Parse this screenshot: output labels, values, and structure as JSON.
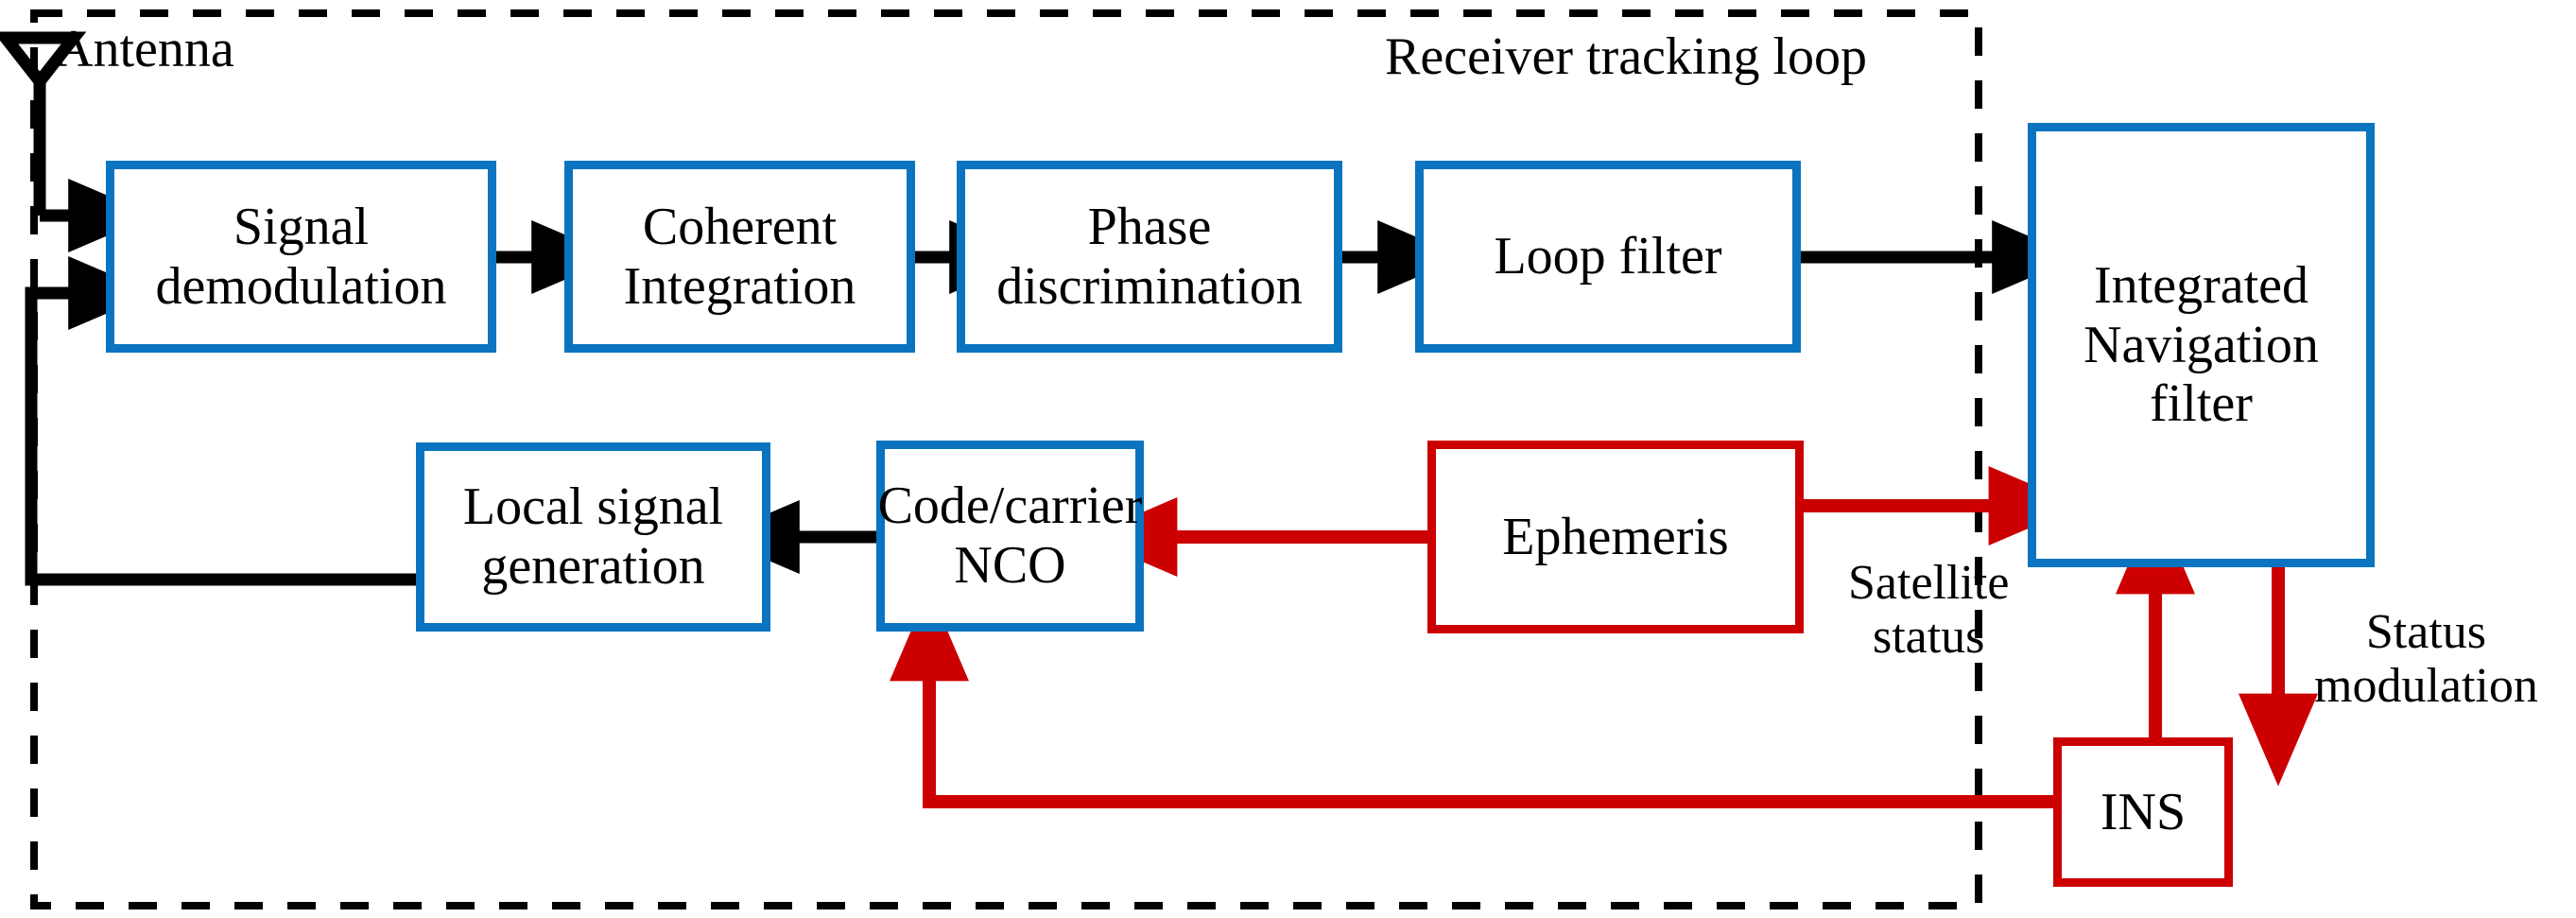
{
  "diagram": {
    "title_label": "Receiver tracking loop",
    "antenna_label": "Antenna",
    "satellite_status_label": "Satellite\nstatus",
    "status_modulation_label": "Status\nmodulation",
    "colors": {
      "blue": "#0a74c0",
      "red": "#cc0000",
      "black": "#000000",
      "background": "#ffffff"
    },
    "blocks": [
      {
        "id": "signal-demodulation",
        "label": "Signal\ndemodulation",
        "color": "blue"
      },
      {
        "id": "coherent-integration",
        "label": "Coherent\nIntegration",
        "color": "blue"
      },
      {
        "id": "phase-discrimination",
        "label": "Phase\ndiscrimination",
        "color": "blue"
      },
      {
        "id": "loop-filter",
        "label": "Loop filter",
        "color": "blue"
      },
      {
        "id": "integrated-navigation-filter",
        "label": "Integrated\nNavigation\nfilter",
        "color": "blue"
      },
      {
        "id": "local-signal-generation",
        "label": "Local signal\ngeneration",
        "color": "blue"
      },
      {
        "id": "code-carrier-nco",
        "label": "Code/carrier\nNCO",
        "color": "blue"
      },
      {
        "id": "ephemeris",
        "label": "Ephemeris",
        "color": "red"
      },
      {
        "id": "ins",
        "label": "INS",
        "color": "red"
      }
    ],
    "connections": [
      {
        "from": "antenna",
        "to": "signal-demodulation",
        "color": "black"
      },
      {
        "from": "local-signal-generation",
        "to": "signal-demodulation",
        "color": "black"
      },
      {
        "from": "signal-demodulation",
        "to": "coherent-integration",
        "color": "black"
      },
      {
        "from": "coherent-integration",
        "to": "phase-discrimination",
        "color": "black"
      },
      {
        "from": "phase-discrimination",
        "to": "loop-filter",
        "color": "black"
      },
      {
        "from": "loop-filter",
        "to": "integrated-navigation-filter",
        "color": "black"
      },
      {
        "from": "code-carrier-nco",
        "to": "local-signal-generation",
        "color": "black"
      },
      {
        "from": "ephemeris",
        "to": "code-carrier-nco",
        "color": "red"
      },
      {
        "from": "ephemeris",
        "to": "integrated-navigation-filter",
        "color": "red",
        "label": "Satellite status"
      },
      {
        "from": "integrated-navigation-filter",
        "to": "ins",
        "color": "red",
        "label": "Status modulation"
      },
      {
        "from": "ins",
        "to": "integrated-navigation-filter",
        "color": "red"
      },
      {
        "from": "ins",
        "to": "code-carrier-nco",
        "color": "red"
      }
    ]
  }
}
